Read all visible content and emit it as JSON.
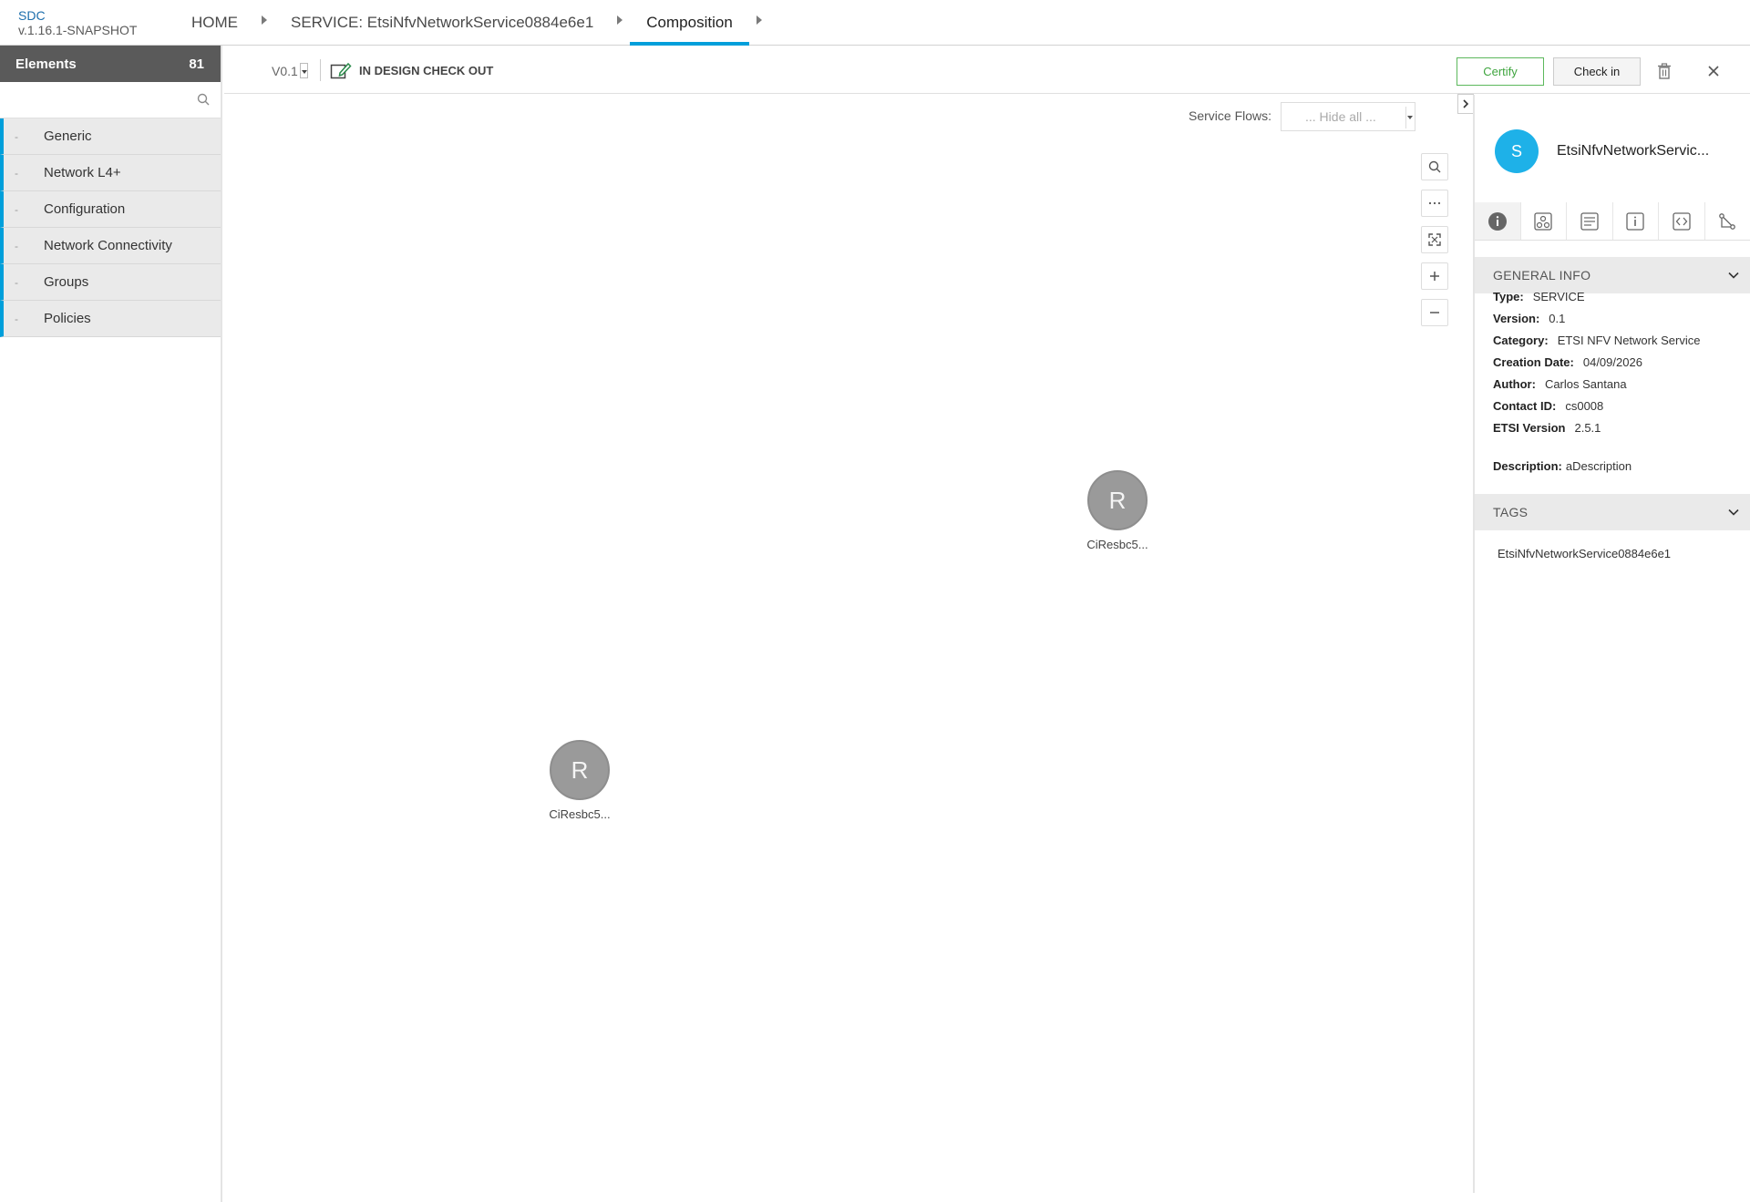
{
  "header": {
    "brand": "SDC",
    "version": "v.1.16.1-SNAPSHOT",
    "breadcrumbs": [
      "HOME",
      "SERVICE: EtsiNfvNetworkService0884e6e1",
      "Composition"
    ]
  },
  "palette": {
    "title": "Elements",
    "count": "81",
    "search_placeholder": "",
    "groups": [
      {
        "dash": "-",
        "label": "Generic"
      },
      {
        "dash": "-",
        "label": "Network L4+"
      },
      {
        "dash": "-",
        "label": "Configuration"
      },
      {
        "dash": "-",
        "label": "Network Connectivity"
      },
      {
        "dash": "-",
        "label": "Groups"
      },
      {
        "dash": "-",
        "label": "Policies"
      }
    ]
  },
  "toolbar": {
    "version": "V0.1",
    "status": "IN DESIGN CHECK OUT",
    "certify_label": "Certify",
    "checkin_label": "Check in",
    "delete_icon": "trash-icon",
    "close_icon": "close-icon"
  },
  "canvas": {
    "service_flows_label": "Service Flows:",
    "service_flows_value": "... Hide all ...",
    "zoom_controls": [
      "search-icon",
      "more-icon",
      "fit-icon",
      "zoom-in-icon",
      "zoom-out-icon"
    ],
    "nodes": [
      {
        "letter": "R",
        "label": "CiResbc5..."
      },
      {
        "letter": "R",
        "label": "CiResbc5..."
      }
    ]
  },
  "right_panel": {
    "avatar_letter": "S",
    "title": "EtsiNfvNetworkServic...",
    "tabs": [
      "info-icon",
      "composition-icon",
      "deployment-icon",
      "properties-icon",
      "api-icon",
      "paths-icon"
    ],
    "general_info": {
      "heading": "GENERAL INFO",
      "rows": [
        {
          "key": "Type:",
          "value": "SERVICE"
        },
        {
          "key": "Version:",
          "value": "0.1"
        },
        {
          "key": "Category:",
          "value": "ETSI NFV Network Service"
        },
        {
          "key": "Creation Date:",
          "value": "04/09/2026"
        },
        {
          "key": "Author:",
          "value": "Carlos Santana"
        },
        {
          "key": "Contact ID:",
          "value": "cs0008"
        },
        {
          "key": "ETSI Version",
          "value": "2.5.1"
        }
      ],
      "description_key": "Description:",
      "description_value": "aDescription"
    },
    "tags": {
      "heading": "TAGS",
      "items": [
        "EtsiNfvNetworkService0884e6e1"
      ]
    }
  },
  "colors": {
    "accent": "#009fdb",
    "certify": "#5cb85c",
    "avatar": "#1eb1e8",
    "node": "#9a9a9a",
    "palette_header": "#5a5a5a"
  }
}
